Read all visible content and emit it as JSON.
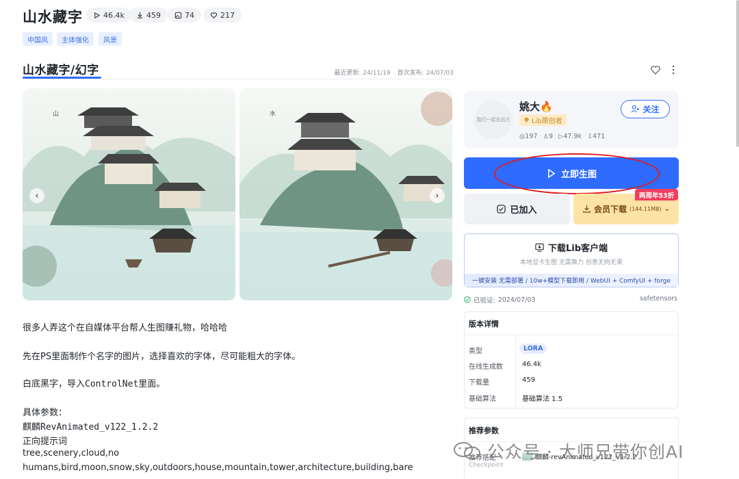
{
  "header": {
    "title": "山水藏字",
    "stats": [
      {
        "icon": "play-icon",
        "value": "46.4k"
      },
      {
        "icon": "download-icon",
        "value": "459"
      },
      {
        "icon": "image-icon",
        "value": "74"
      },
      {
        "icon": "heart-icon",
        "value": "217"
      }
    ],
    "tags": [
      "中国风",
      "主体强化",
      "风景"
    ]
  },
  "version": {
    "title": "山水藏字/幻字",
    "last_update_label": "最近更新:",
    "last_update": "24/11/19",
    "first_publish_label": "首次发布:",
    "first_publish": "24/07/03"
  },
  "gallery": {
    "prev": "‹",
    "next": "›"
  },
  "description": {
    "lines": [
      "很多人弄这个在自媒体平台帮人生图赚礼物，哈哈哈",
      "先在PS里面制作个名字的图片，选择喜欢的字体，尽可能粗大的字体。",
      "白底黑字，导入ControlNet里面。",
      "具体参数：",
      "麒麟RevAnimated_v122_1.2.2",
      "正向提示词",
      "tree,scenery,cloud,no",
      "humans,bird,moon,snow,sky,outdoors,house,mountain,tower,architecture,building,bare"
    ]
  },
  "author": {
    "name": "姚大",
    "fire": "🔥",
    "badge": "Lib原创者",
    "avatar_text": "我们一起去远方",
    "follow_label": "关注",
    "stats": [
      {
        "icon": "users-icon",
        "value": "197"
      },
      {
        "icon": "thumb-icon",
        "value": "9"
      },
      {
        "icon": "play-icon",
        "value": "47.9k"
      },
      {
        "icon": "download-icon",
        "value": "471"
      }
    ]
  },
  "actions": {
    "generate_label": "立即生图",
    "added_label": "已加入",
    "member_download_label": "会员下载",
    "member_download_size": "(144.11MB)",
    "promo": "两周年53折"
  },
  "client": {
    "title": "下载Lib客户端",
    "subtitle": "本地显卡生图 无需算力 创意无拘无束",
    "strip": "一键安装 无需部署 / 10w+模型下载即用 / WebUI + ComfyUI + forge"
  },
  "verify": {
    "label": "已验证:",
    "date": "2024/07/03",
    "format": "safetensors"
  },
  "details": {
    "title": "版本详情",
    "rows": [
      {
        "label": "类型",
        "value": "LORA"
      },
      {
        "label": "在线生成数",
        "value": "46.4k"
      },
      {
        "label": "下载量",
        "value": "459"
      },
      {
        "label": "基础算法",
        "value": "基础算法 1.5"
      }
    ]
  },
  "recommend": {
    "title": "推荐参数",
    "label": "推荐搭配",
    "sublabel": "Checkpoint",
    "value": "麒麟-revAnimated_v122_V1.2.2"
  },
  "watermark": {
    "text": "公众号 · 大师兄带你创AI"
  }
}
